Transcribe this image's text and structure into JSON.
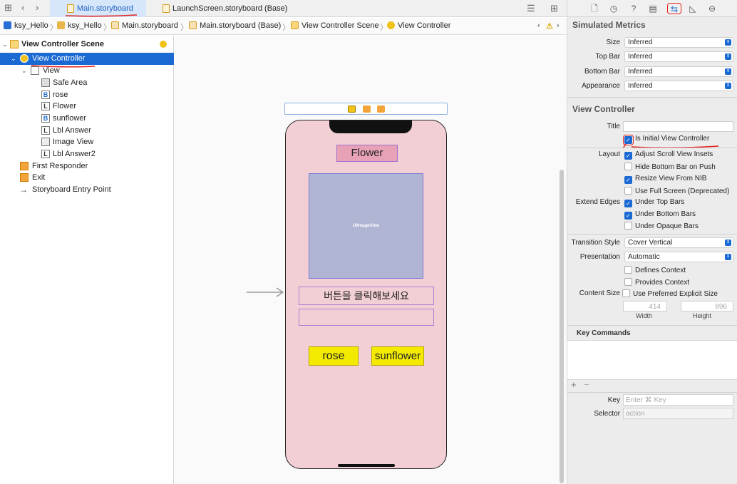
{
  "tabs": [
    {
      "label": "Main.storyboard",
      "active": true
    },
    {
      "label": "LaunchScreen.storyboard (Base)",
      "active": false
    }
  ],
  "breadcrumb": [
    "ksy_Hello",
    "ksy_Hello",
    "Main.storyboard",
    "Main.storyboard (Base)",
    "View Controller Scene",
    "View Controller"
  ],
  "outline": {
    "scene": "View Controller Scene",
    "items": [
      {
        "label": "View Controller",
        "icon": "view-controller-icon"
      },
      {
        "label": "View",
        "icon": "view-icon"
      },
      {
        "label": "Safe Area",
        "icon": "safe-area-icon"
      },
      {
        "label": "rose",
        "icon": "button-icon",
        "glyph": "B"
      },
      {
        "label": "Flower",
        "icon": "label-icon",
        "glyph": "L"
      },
      {
        "label": "sunflower",
        "icon": "button-icon",
        "glyph": "B"
      },
      {
        "label": "Lbl Answer",
        "icon": "label-icon",
        "glyph": "L"
      },
      {
        "label": "Image View",
        "icon": "image-view-icon"
      },
      {
        "label": "Lbl Answer2",
        "icon": "label-icon",
        "glyph": "L"
      },
      {
        "label": "First Responder",
        "icon": "first-responder-icon"
      },
      {
        "label": "Exit",
        "icon": "exit-icon"
      },
      {
        "label": "Storyboard Entry Point",
        "icon": "arrow-right-icon"
      }
    ]
  },
  "canvas": {
    "flower_label": "Flower",
    "image_view_label": "UIImageView",
    "answer_label": "버튼을 클릭해보세요",
    "rose_button": "rose",
    "sunflower_button": "sunflower"
  },
  "inspector": {
    "simulated_metrics": {
      "title": "Simulated Metrics",
      "rows": [
        {
          "label": "Size",
          "value": "Inferred"
        },
        {
          "label": "Top Bar",
          "value": "Inferred"
        },
        {
          "label": "Bottom Bar",
          "value": "Inferred"
        },
        {
          "label": "Appearance",
          "value": "Inferred"
        }
      ]
    },
    "view_controller": {
      "title": "View Controller",
      "title_label": "Title",
      "is_initial": "Is Initial View Controller",
      "layout_label": "Layout",
      "layout_options": [
        {
          "label": "Adjust Scroll View Insets",
          "checked": true
        },
        {
          "label": "Hide Bottom Bar on Push",
          "checked": false
        },
        {
          "label": "Resize View From NIB",
          "checked": true
        },
        {
          "label": "Use Full Screen (Deprecated)",
          "checked": false
        }
      ],
      "extend_edges_label": "Extend Edges",
      "extend_edges": [
        {
          "label": "Under Top Bars",
          "checked": true
        },
        {
          "label": "Under Bottom Bars",
          "checked": true
        },
        {
          "label": "Under Opaque Bars",
          "checked": false
        }
      ],
      "transition_style_label": "Transition Style",
      "transition_style": "Cover Vertical",
      "presentation_label": "Presentation",
      "presentation": "Automatic",
      "defines_context": "Defines Context",
      "provides_context": "Provides Context",
      "content_size_label": "Content Size",
      "use_preferred": "Use Preferred Explicit Size",
      "width_value": "414",
      "height_value": "896",
      "width_label": "Width",
      "height_label": "Height"
    },
    "key_commands": {
      "title": "Key Commands",
      "key_label": "Key",
      "key_placeholder": "Enter ⌘ Key",
      "selector_label": "Selector",
      "selector_placeholder": "action"
    }
  },
  "colors": {
    "accent": "#1b6ad4",
    "phone_bg": "#f2cfd4",
    "button_yellow": "#f3ea00",
    "annotation_red": "#e3231e"
  }
}
